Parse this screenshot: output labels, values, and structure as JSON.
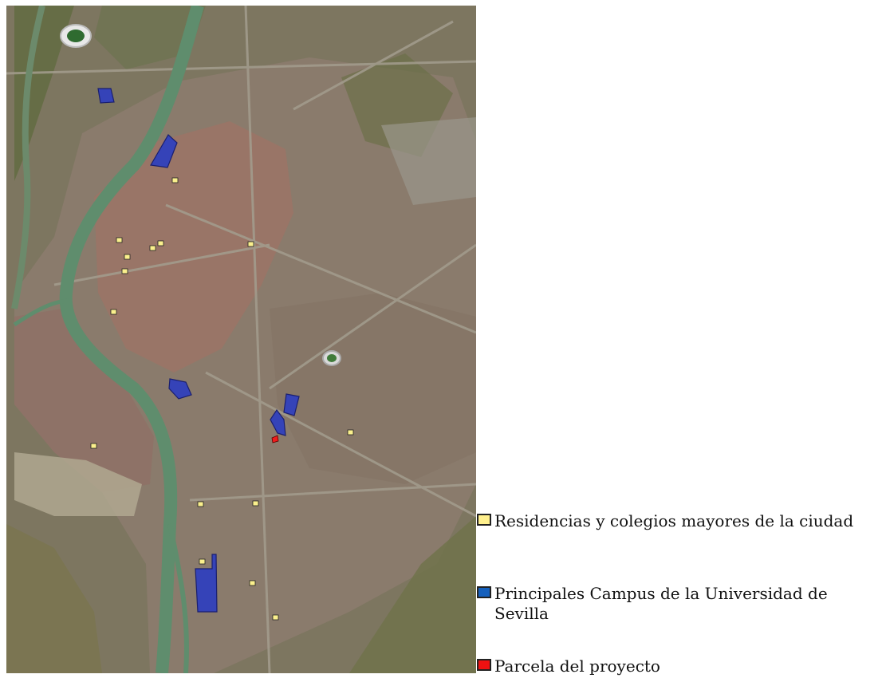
{
  "map": {
    "kind": "aerial-photo",
    "city": "Sevilla",
    "marker_colors": {
      "residencias": "#fbf08d",
      "campus": "#3543b8",
      "parcela": "#ee1c1c"
    }
  },
  "legend": {
    "items": [
      {
        "label": "Residencias y colegios mayores de la ciudad",
        "color": "#fff08d"
      },
      {
        "label": "Principales Campus de la Universidad de Sevilla",
        "color": "#1560bd"
      },
      {
        "label": "Parcela del proyecto",
        "color": "#ee1111"
      }
    ]
  }
}
